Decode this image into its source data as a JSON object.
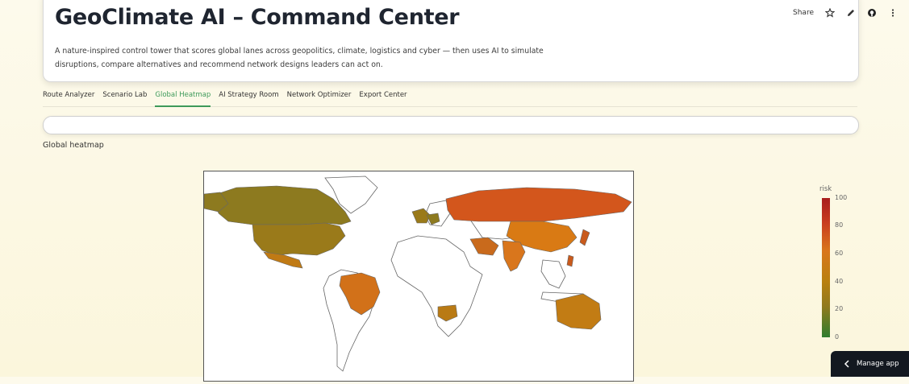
{
  "header": {
    "title": "GeoClimate AI – Command Center",
    "description": "A nature-inspired control tower that scores global lanes across geopolitics, climate, logistics and cyber — then uses AI to simulate disruptions, compare alternatives and recommend network designs leaders can act on."
  },
  "toolbar": {
    "share_label": "Share",
    "icons": [
      "star-icon",
      "edit-icon",
      "github-icon",
      "more-icon"
    ]
  },
  "tabs": [
    {
      "label": "Route Analyzer",
      "active": false
    },
    {
      "label": "Scenario Lab",
      "active": false
    },
    {
      "label": "Global Heatmap",
      "active": true
    },
    {
      "label": "AI Strategy Room",
      "active": false
    },
    {
      "label": "Network Optimizer",
      "active": false
    },
    {
      "label": "Export Center",
      "active": false
    }
  ],
  "section": {
    "label": "Global heatmap"
  },
  "colors": {
    "accent": "#3d9a5a",
    "low_risk": "#2f7d2f",
    "mid_risk": "#b8800f",
    "high_risk": "#a81d1d"
  },
  "colorbar": {
    "title": "risk",
    "ticks": [
      "100",
      "80",
      "60",
      "40",
      "20",
      "0"
    ],
    "range": [
      0,
      100
    ]
  },
  "map": {
    "type": "choropleth",
    "colored_regions": [
      {
        "name": "Canada",
        "color": "#8d7a1f"
      },
      {
        "name": "United States",
        "color": "#9a7a1a"
      },
      {
        "name": "Mexico",
        "color": "#c07a14"
      },
      {
        "name": "Brazil",
        "color": "#d27119"
      },
      {
        "name": "United Kingdom / Western Europe",
        "color": "#9a7a1a"
      },
      {
        "name": "Germany",
        "color": "#8d7a1f"
      },
      {
        "name": "Russia",
        "color": "#d3561c"
      },
      {
        "name": "China",
        "color": "#d97a14"
      },
      {
        "name": "India",
        "color": "#d9761c"
      },
      {
        "name": "Middle East",
        "color": "#c96a1c"
      },
      {
        "name": "Japan",
        "color": "#c95a1c"
      },
      {
        "name": "Philippines",
        "color": "#c95a1c"
      },
      {
        "name": "Australia",
        "color": "#c27c14"
      },
      {
        "name": "South Africa",
        "color": "#b97a14"
      }
    ]
  },
  "manage_app": {
    "label": "Manage app"
  }
}
